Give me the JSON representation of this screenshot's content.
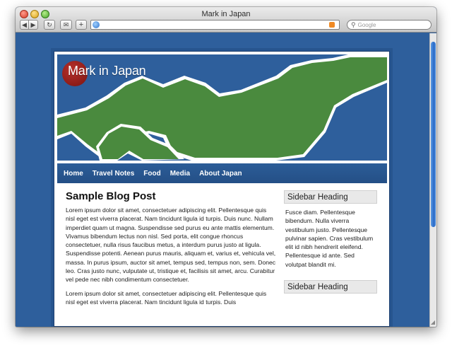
{
  "browser": {
    "window_title": "Mark in Japan",
    "search_placeholder": "Google",
    "address_value": ""
  },
  "site": {
    "title": "Mark in Japan",
    "nav": [
      "Home",
      "Travel Notes",
      "Food",
      "Media",
      "About Japan"
    ]
  },
  "post": {
    "title": "Sample Blog Post",
    "paragraphs": [
      "Lorem ipsum dolor sit amet, consectetuer adipiscing elit. Pellentesque quis nisl eget est viverra placerat. Nam tincidunt ligula id turpis. Duis nunc. Nullam imperdiet quam ut magna. Suspendisse sed purus eu ante mattis elementum. Vivamus bibendum lectus non nisl. Sed porta, elit congue rhoncus consectetuer, nulla risus faucibus metus, a interdum purus justo at ligula. Suspendisse potenti. Aenean purus mauris, aliquam et, varius et, vehicula vel, massa. In purus ipsum, auctor sit amet, tempus sed, tempus non, sem. Donec leo. Cras justo nunc, vulputate ut, tristique et, facilisis sit amet, arcu. Curabitur vel pede nec nibh condimentum consectetuer.",
      "Lorem ipsum dolor sit amet, consectetuer adipiscing elit. Pellentesque quis nisl eget est viverra placerat. Nam tincidunt ligula id turpis. Duis"
    ]
  },
  "sidebar": {
    "blocks": [
      {
        "heading": "Sidebar Heading",
        "text": "Fusce diam. Pellentesque bibendum. Nulla viverra vestibulum justo. Pellentesque pulvinar sapien. Cras vestibulum elit id nibh hendrerit eleifend. Pellentesque id ante. Sed volutpat blandit mi."
      },
      {
        "heading": "Sidebar Heading",
        "text": ""
      }
    ]
  },
  "colors": {
    "page_background": "#2e5f9c",
    "land": "#4a8a3e",
    "nav_bar": "#2c5d98",
    "logo_red": "#9b2420"
  }
}
